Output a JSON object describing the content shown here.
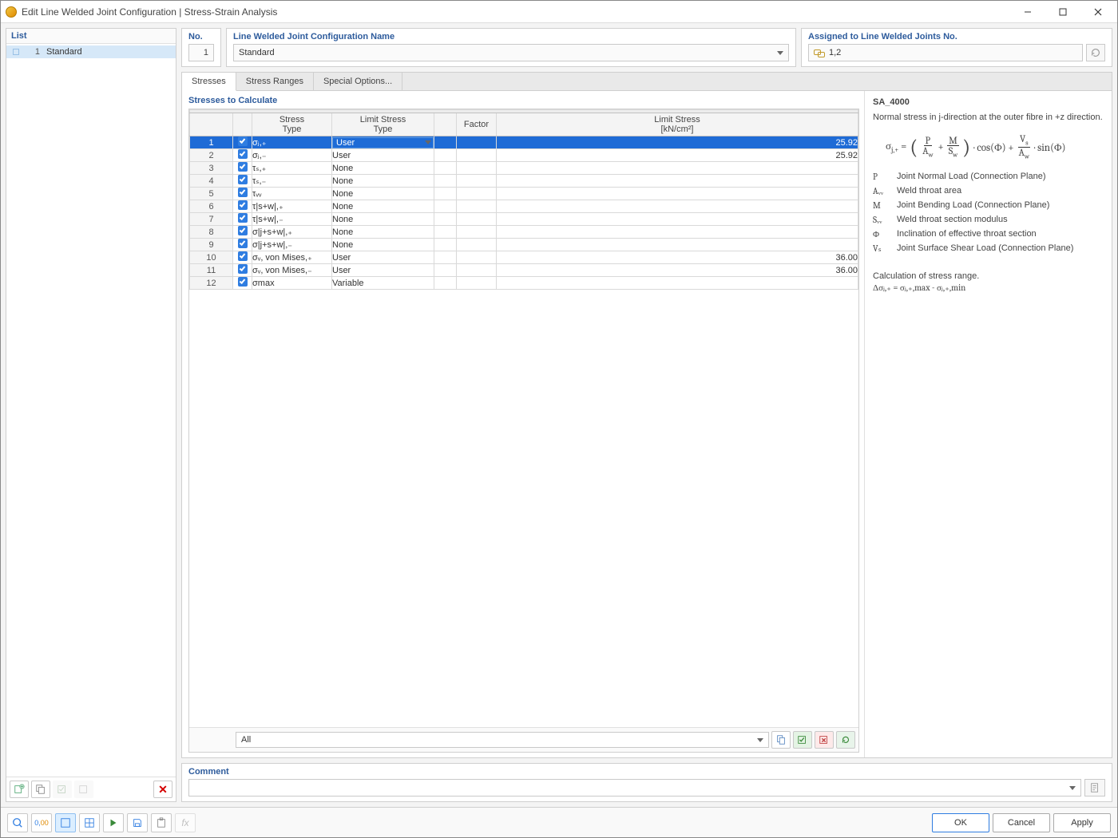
{
  "window": {
    "title": "Edit Line Welded Joint Configuration | Stress-Strain Analysis"
  },
  "left": {
    "header": "List",
    "items": [
      {
        "num": "1",
        "label": "Standard"
      }
    ]
  },
  "hdr": {
    "no_label": "No.",
    "no_value": "1",
    "name_label": "Line Welded Joint Configuration Name",
    "name_value": "Standard",
    "assign_label": "Assigned to Line Welded Joints No.",
    "assign_value": "1,2"
  },
  "tabs": {
    "t1": "Stresses",
    "t2": "Stress Ranges",
    "t3": "Special Options..."
  },
  "grid": {
    "section": "Stresses to Calculate",
    "col_stress": "Stress\nType",
    "col_limit_type": "Limit Stress\nType",
    "col_factor": "Factor",
    "col_limit": "Limit Stress\n[kN/cm²]",
    "filter": "All",
    "rows": [
      {
        "n": "1",
        "st": "σⱼ,₊",
        "lt": "User",
        "lim": "25.92",
        "sel": true,
        "drop": true
      },
      {
        "n": "2",
        "st": "σⱼ,₋",
        "lt": "User",
        "lim": "25.92"
      },
      {
        "n": "3",
        "st": "τₛ,₊",
        "lt": "None",
        "lim": ""
      },
      {
        "n": "4",
        "st": "τₛ,₋",
        "lt": "None",
        "lim": ""
      },
      {
        "n": "5",
        "st": "τᵥᵥ",
        "lt": "None",
        "lim": ""
      },
      {
        "n": "6",
        "st": "τ|s+w|,₊",
        "lt": "None",
        "lim": ""
      },
      {
        "n": "7",
        "st": "τ|s+w|,₋",
        "lt": "None",
        "lim": ""
      },
      {
        "n": "8",
        "st": "σ|j+s+w|,₊",
        "lt": "None",
        "lim": ""
      },
      {
        "n": "9",
        "st": "σ|j+s+w|,₋",
        "lt": "None",
        "lim": ""
      },
      {
        "n": "10",
        "st": "σᵥ, von Mises,₊",
        "lt": "User",
        "lim": "36.00"
      },
      {
        "n": "11",
        "st": "σᵥ, von Mises,₋",
        "lt": "User",
        "lim": "36.00"
      },
      {
        "n": "12",
        "st": "σmax",
        "lt": "Variable",
        "lim": ""
      }
    ]
  },
  "info": {
    "title": "SA_4000",
    "desc": "Normal stress in j-direction at the outer fibre in +z direction.",
    "legend": [
      {
        "s": "P",
        "d": "Joint Normal Load (Connection Plane)"
      },
      {
        "s": "Aᵥᵥ",
        "d": "Weld throat area"
      },
      {
        "s": "M",
        "d": "Joint Bending Load (Connection Plane)"
      },
      {
        "s": "Sᵥᵥ",
        "d": "Weld throat section modulus"
      },
      {
        "s": "Φ",
        "d": "Inclination of effective throat section"
      },
      {
        "s": "Vₛ",
        "d": "Joint Surface Shear Load (Connection Plane)"
      }
    ],
    "calc_label": "Calculation of stress range.",
    "calc_formula": "Δσⱼ,₊ = σⱼ,₊,max - σⱼ,₊,min"
  },
  "comment": {
    "label": "Comment"
  },
  "buttons": {
    "ok": "OK",
    "cancel": "Cancel",
    "apply": "Apply"
  }
}
